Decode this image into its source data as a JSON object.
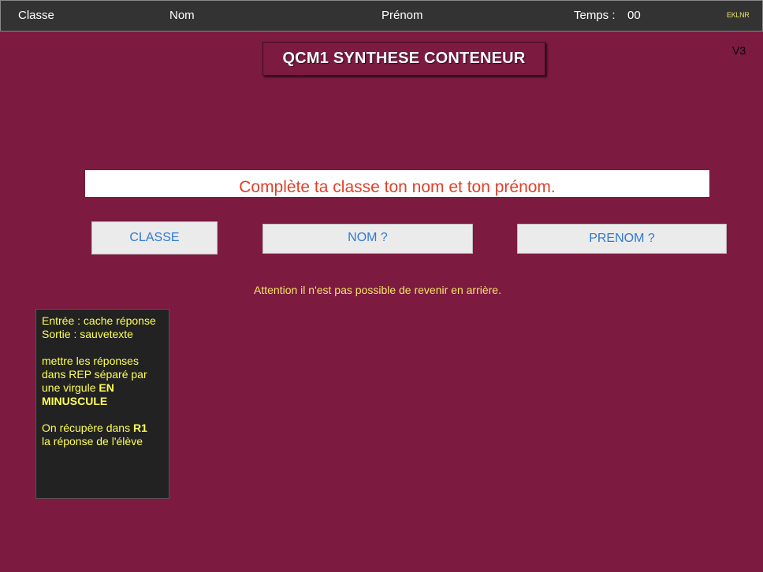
{
  "header": {
    "classe_label": "Classe",
    "nom_label": "Nom",
    "prenom_label": "Prénom",
    "temps_label": "Temps :",
    "temps_value": "00",
    "code": "EKLNR"
  },
  "title": "QCM1 SYNTHESE CONTENEUR",
  "version": "V3",
  "prompt": "Complète ta classe ton nom et ton prénom.",
  "buttons": {
    "classe": "CLASSE",
    "nom": "NOM ?",
    "prenom": "PRENOM ?"
  },
  "warning": "Attention il n'est pas possible de revenir en arrière.",
  "note": {
    "line1": "Entrée : cache réponse",
    "line2": "Sortie : sauvetexte",
    "line3": "mettre les réponses",
    "line4": "dans REP séparé par",
    "line5_text": "une virgule ",
    "line5_bold": "EN",
    "line6_bold": "MINUSCULE",
    "line7_text": "On récupère dans ",
    "line7_bold": "R1",
    "line8": "la réponse de l'élève"
  },
  "colors": {
    "background": "#7c1a40",
    "topbar": "#333333",
    "prompt_text": "#e0402a",
    "button_text": "#2f7ad0",
    "warning_text": "#f5e56a",
    "note_text": "#ffff55"
  }
}
